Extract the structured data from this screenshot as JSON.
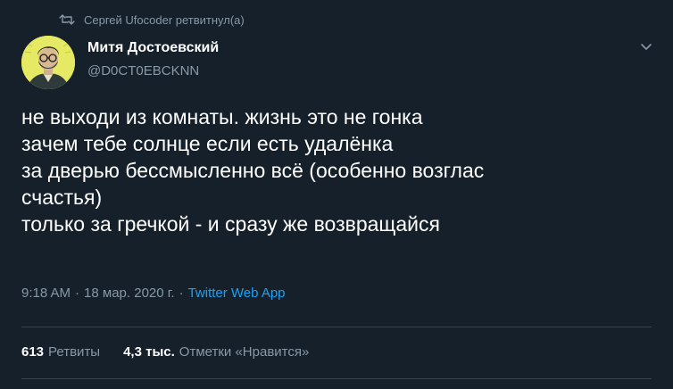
{
  "retweet": {
    "text": "Сергей Ufocoder ретвитнул(а)",
    "icon": "retweet-icon"
  },
  "author": {
    "name": "Митя Достоевский",
    "handle": "@D0CT0EBCKNN",
    "avatar_bg": "#e8eb6a"
  },
  "tweet": {
    "lines": [
      "не выходи из комнаты. жизнь это не гонка",
      "зачем тебе солнце если есть удалёнка",
      "за дверью бессмысленно всё (особенно возглас",
      "счастья)",
      "только за гречкой - и сразу же возвращайся"
    ]
  },
  "meta": {
    "time": "9:18 AM",
    "separator": "·",
    "date": "18 мар. 2020 г.",
    "source": "Twitter Web App"
  },
  "stats": {
    "retweets_count": "613",
    "retweets_label": "Ретвиты",
    "likes_count": "4,3 тыс.",
    "likes_label": "Отметки «Нравится»"
  },
  "colors": {
    "background": "#15202b",
    "muted": "#8899a6",
    "accent": "#1da1f2",
    "divider": "#38444d"
  }
}
